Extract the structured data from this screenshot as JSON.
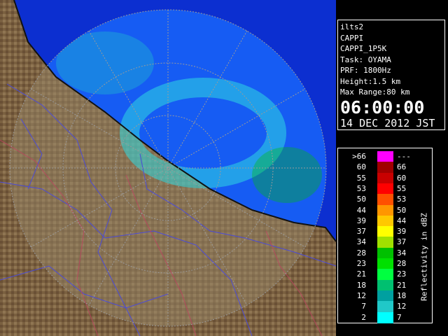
{
  "info": {
    "site": "ilts2",
    "product": "CAPPI",
    "product_id": "CAPPI_1P5K",
    "task": "Task: OYAMA",
    "prf": "PRF: 1800Hz",
    "height": "Height:1.5 km",
    "max_range": "Max Range:80 km",
    "time": "06:00:00",
    "date": "14 DEC 2012 JST"
  },
  "legend": {
    "title": "Reflectivity in dBZ",
    "rows": [
      {
        "lo": ">66",
        "hi": "---",
        "color": "#ff00ff"
      },
      {
        "lo": "60",
        "hi": "66",
        "color": "#a00000"
      },
      {
        "lo": "55",
        "hi": "60",
        "color": "#c80000"
      },
      {
        "lo": "53",
        "hi": "55",
        "color": "#ff0000"
      },
      {
        "lo": "50",
        "hi": "53",
        "color": "#ff5000"
      },
      {
        "lo": "44",
        "hi": "50",
        "color": "#ff9600"
      },
      {
        "lo": "39",
        "hi": "44",
        "color": "#ffc800"
      },
      {
        "lo": "37",
        "hi": "39",
        "color": "#ffff00"
      },
      {
        "lo": "34",
        "hi": "37",
        "color": "#a0e000"
      },
      {
        "lo": "28",
        "hi": "34",
        "color": "#00c000"
      },
      {
        "lo": "23",
        "hi": "28",
        "color": "#00e000"
      },
      {
        "lo": "21",
        "hi": "23",
        "color": "#00ff40"
      },
      {
        "lo": "18",
        "hi": "21",
        "color": "#00c070"
      },
      {
        "lo": "12",
        "hi": "18",
        "color": "#00a0a0"
      },
      {
        "lo": "7",
        "hi": "12",
        "color": "#20c8c8"
      },
      {
        "lo": "2",
        "hi": "7",
        "color": "#00ffff"
      }
    ]
  },
  "map": {
    "sea_color": "#0c2fd0",
    "radar_sea_color": "#1a6cff",
    "land_color": "#7a6040",
    "echo_color": "#30d8e0",
    "boundary_color": "#4b4bd8"
  }
}
